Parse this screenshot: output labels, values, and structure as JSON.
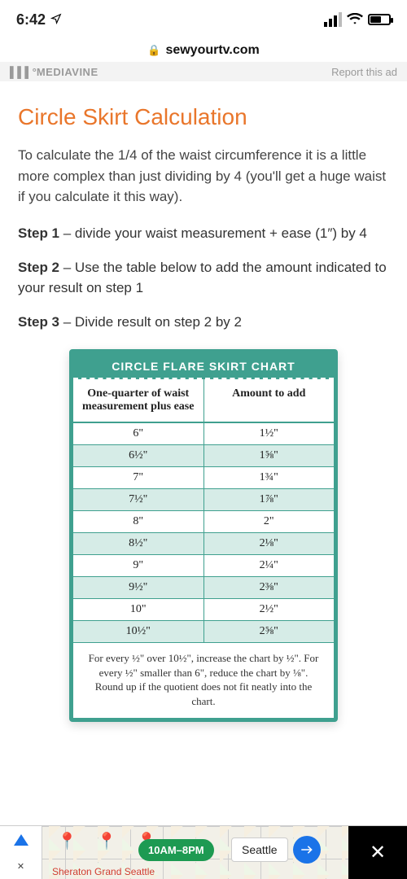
{
  "status": {
    "time": "6:42"
  },
  "browser": {
    "domain": "sewyourtv.com"
  },
  "ad_band": {
    "network": "MEDIAVINE",
    "report": "Report this ad"
  },
  "page": {
    "title": "Circle Skirt Calculation",
    "intro": "To calculate the 1/4 of the waist circumference it is a little more complex than just dividing by 4 (you'll get a huge waist if you calculate it this way).",
    "steps": [
      {
        "label": "Step 1",
        "text": " – divide your waist measurement + ease (1″) by 4"
      },
      {
        "label": "Step 2",
        "text": " – Use the table below to add the amount indicated to your result on step 1"
      },
      {
        "label": "Step 3",
        "text": " – Divide result on step 2 by 2"
      }
    ]
  },
  "chart": {
    "title": "CIRCLE FLARE SKIRT CHART",
    "col1": "One-quarter of waist measurement plus ease",
    "col2": "Amount to add",
    "note": "For every ½\" over 10½\", increase the chart by ½\". For every ½\" smaller than 6\", reduce the chart by ⅛\". Round up if the quotient does not fit neatly into the chart."
  },
  "chart_data": {
    "type": "table",
    "columns": [
      "One-quarter of waist measurement plus ease",
      "Amount to add"
    ],
    "rows": [
      {
        "measure": "6\"",
        "add": "1½\""
      },
      {
        "measure": "6½\"",
        "add": "1⅝\""
      },
      {
        "measure": "7\"",
        "add": "1¾\""
      },
      {
        "measure": "7½\"",
        "add": "1⅞\""
      },
      {
        "measure": "8\"",
        "add": "2\""
      },
      {
        "measure": "8½\"",
        "add": "2⅛\""
      },
      {
        "measure": "9\"",
        "add": "2¼\""
      },
      {
        "measure": "9½\"",
        "add": "2⅜\""
      },
      {
        "measure": "10\"",
        "add": "2½\""
      },
      {
        "measure": "10½\"",
        "add": "2⅝\""
      }
    ]
  },
  "bottom_ad": {
    "hours": "10AM–8PM",
    "city": "Seattle",
    "caption": "Sheraton Grand Seattle"
  }
}
